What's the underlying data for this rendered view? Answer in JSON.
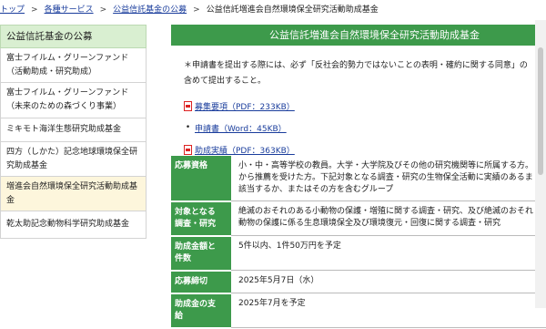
{
  "breadcrumb": {
    "items": [
      "トップ",
      "各種サービス",
      "公益信託基金の公募"
    ],
    "current": "公益信託増進会自然環境保全研究活動助成基金",
    "separator": ">"
  },
  "sidebar": {
    "title": "公益信託基金の公募",
    "items": [
      {
        "line1": "富士フイルム・グリーンファンド",
        "line2": "（活動助成・研究助成）"
      },
      {
        "line1": "富士フイルム・グリーンファンド",
        "line2": "（未来のための森づくり事業）"
      },
      {
        "line1": "ミキモト海洋生態研究助成基金",
        "line2": ""
      },
      {
        "line1": "四方（しかた）記念地球環境保全研",
        "line2": "究助成基金"
      },
      {
        "line1": "増進会自然環境保全研究活動助成基",
        "line2": "金"
      },
      {
        "line1": "乾太助記念動物科学研究助成基金",
        "line2": ""
      }
    ],
    "active_index": 4
  },
  "main": {
    "title": "公益信託増進会自然環境保全研究活動助成基金",
    "notice_line1": "＊申請書を提出する際には、必ず「反社会的勢力ではないことの表明・確約に関する同意」の",
    "notice_line2": "含めて提出すること。",
    "documents": [
      {
        "label": "募集要項（PDF：233KB）",
        "icon": "pdf-icon"
      },
      {
        "label": "申請書（Word：45KB）",
        "icon": "bullet"
      },
      {
        "label": "助成実績（PDF：363KB）",
        "icon": "pdf-icon"
      }
    ]
  },
  "info": {
    "rows": [
      {
        "header_l1": "応募資格",
        "header_l2": "",
        "lines": [
          "小・中・高等学校の教員。大学・大学院及びその他の研究機関等に所属する方。",
          "から推薦を受けた方。下記対象となる調査・研究の生物保全活動に実績のあるま",
          "該当するか、またはその方を含むグループ"
        ]
      },
      {
        "header_l1": "対象となる",
        "header_l2": "調査・研究",
        "lines": [
          "絶滅のおそれのある小動物の保護・増殖に関する調査・研究、及び絶滅のおそれ",
          "動物の保護に係る生息環境保全及び環境復元・回復に関する調査・研究"
        ]
      },
      {
        "header_l1": "助成金額と",
        "header_l2": "件数",
        "lines": [
          "5件以内、1件50万円を予定"
        ]
      },
      {
        "header_l1": "応募締切",
        "header_l2": "",
        "lines": [
          "2025年5月7日（水）"
        ]
      },
      {
        "header_l1": "助成金の支",
        "header_l2": "給",
        "lines": [
          "2025年7月を予定"
        ]
      }
    ]
  },
  "colors": {
    "accent": "#3d9a4b",
    "sidebar_header": "#d9efd1",
    "active_item": "#fdf6dc",
    "link": "#1a3d9c"
  }
}
